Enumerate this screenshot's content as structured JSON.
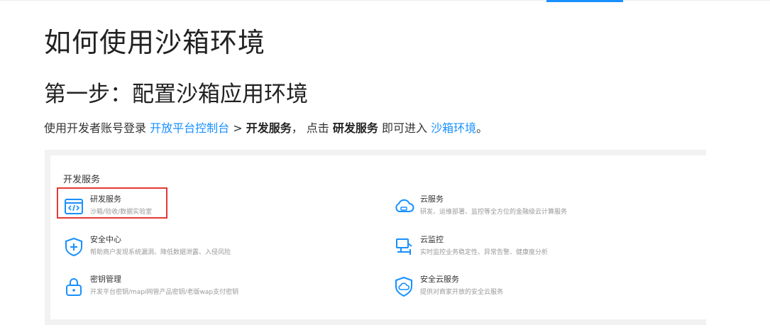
{
  "page": {
    "title": "如何使用沙箱环境",
    "step_title": "第一步：配置沙箱应用环境"
  },
  "intro": {
    "part1": "使用开发者账号登录 ",
    "link_console": "开放平台控制台",
    "arrow": " > ",
    "bold_dev": "开发服务",
    "part2": "， 点击 ",
    "bold_dev2": "研发服务",
    "part3": " 即可进入 ",
    "link_sandbox": "沙箱环境",
    "end": "。"
  },
  "panel": {
    "heading": "开发服务",
    "services": [
      {
        "name": "研发服务",
        "desc": "沙箱/验收/数据实验室",
        "icon": "code-window-icon"
      },
      {
        "name": "云服务",
        "desc": "研发、运维部署、监控等全方位的金融级云计算服务",
        "icon": "cloud-icon"
      },
      {
        "name": "安全中心",
        "desc": "帮助商户发现系统漏洞、降低数据泄露、入侵风险",
        "icon": "shield-plus-icon"
      },
      {
        "name": "云监控",
        "desc": "实时监控业务稳定性、异常告警、健康度分析",
        "icon": "monitor-camera-icon"
      },
      {
        "name": "密钥管理",
        "desc": "开发平台密钥/mapi网管产品密钥/老版wap支付密钥",
        "icon": "lock-icon"
      },
      {
        "name": "安全云服务",
        "desc": "提供对商家开放的安全云服务",
        "icon": "shield-cloud-icon"
      }
    ]
  },
  "colors": {
    "accent": "#1890ff",
    "highlight_border": "#e53935"
  }
}
